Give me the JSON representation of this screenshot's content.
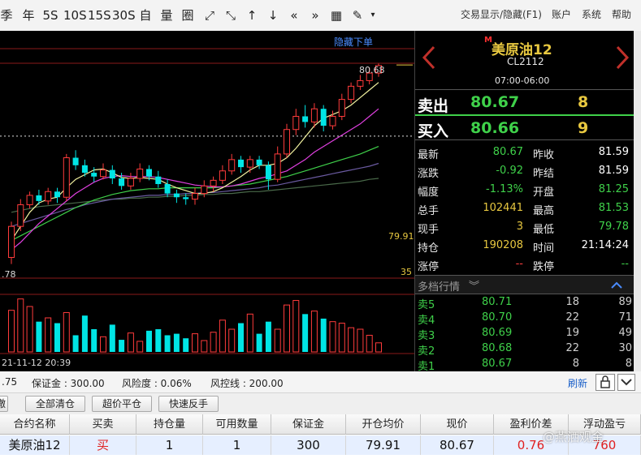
{
  "toolbar": {
    "periods": [
      "季",
      "年",
      "5S",
      "10S",
      "15S",
      "30S",
      "自",
      "量",
      "圈"
    ],
    "tools": [
      "⤢",
      "⤡",
      "↑",
      "↓",
      "«",
      "»",
      "▦",
      "✎",
      "▾"
    ],
    "right": {
      "f1": "交易显示/隐藏(F1)",
      "account": "账户",
      "system": "系统",
      "help": "帮助"
    }
  },
  "chart": {
    "hide_order": "隐藏下单",
    "high_label": "80.68",
    "price_line_label": "79.91",
    "left_low_label": ".78",
    "ma_label": "35",
    "date_label": "21-11-12 20:39"
  },
  "chart_data": {
    "type": "candlestick",
    "candles": [
      {
        "o": 78.62,
        "c": 78.95,
        "h": 79.0,
        "l": 78.55
      },
      {
        "o": 78.95,
        "c": 79.18,
        "h": 79.24,
        "l": 78.9
      },
      {
        "o": 79.18,
        "c": 79.28,
        "h": 79.32,
        "l": 79.14
      },
      {
        "o": 79.28,
        "c": 79.22,
        "h": 79.34,
        "l": 79.18
      },
      {
        "o": 79.22,
        "c": 79.32,
        "h": 79.36,
        "l": 79.18
      },
      {
        "o": 79.32,
        "c": 79.26,
        "h": 79.36,
        "l": 79.2
      },
      {
        "o": 79.26,
        "c": 79.68,
        "h": 79.72,
        "l": 79.22
      },
      {
        "o": 79.68,
        "c": 79.6,
        "h": 79.76,
        "l": 79.55
      },
      {
        "o": 79.6,
        "c": 79.52,
        "h": 79.66,
        "l": 79.48
      },
      {
        "o": 79.52,
        "c": 79.48,
        "h": 79.58,
        "l": 79.42
      },
      {
        "o": 79.48,
        "c": 79.55,
        "h": 79.62,
        "l": 79.45
      },
      {
        "o": 79.55,
        "c": 79.46,
        "h": 79.6,
        "l": 79.4
      },
      {
        "o": 79.46,
        "c": 79.38,
        "h": 79.52,
        "l": 79.34
      },
      {
        "o": 79.38,
        "c": 79.46,
        "h": 79.52,
        "l": 79.34
      },
      {
        "o": 79.46,
        "c": 79.56,
        "h": 79.62,
        "l": 79.42
      },
      {
        "o": 79.56,
        "c": 79.48,
        "h": 79.6,
        "l": 79.44
      },
      {
        "o": 79.48,
        "c": 79.4,
        "h": 79.54,
        "l": 79.36
      },
      {
        "o": 79.4,
        "c": 79.3,
        "h": 79.45,
        "l": 79.26
      },
      {
        "o": 79.3,
        "c": 79.26,
        "h": 79.34,
        "l": 79.2
      },
      {
        "o": 79.26,
        "c": 79.24,
        "h": 79.3,
        "l": 79.18
      },
      {
        "o": 79.24,
        "c": 79.3,
        "h": 79.36,
        "l": 79.18
      },
      {
        "o": 79.3,
        "c": 79.38,
        "h": 79.44,
        "l": 79.26
      },
      {
        "o": 79.38,
        "c": 79.44,
        "h": 79.48,
        "l": 79.32
      },
      {
        "o": 79.44,
        "c": 79.54,
        "h": 79.6,
        "l": 79.4
      },
      {
        "o": 79.54,
        "c": 79.66,
        "h": 79.72,
        "l": 79.5
      },
      {
        "o": 79.66,
        "c": 79.58,
        "h": 79.7,
        "l": 79.52
      },
      {
        "o": 79.58,
        "c": 79.66,
        "h": 79.7,
        "l": 79.52
      },
      {
        "o": 79.66,
        "c": 79.6,
        "h": 79.7,
        "l": 79.56
      },
      {
        "o": 79.6,
        "c": 79.45,
        "h": 79.64,
        "l": 79.34
      },
      {
        "o": 79.45,
        "c": 79.72,
        "h": 79.8,
        "l": 79.42
      },
      {
        "o": 79.72,
        "c": 79.98,
        "h": 80.04,
        "l": 79.68
      },
      {
        "o": 79.98,
        "c": 80.12,
        "h": 80.2,
        "l": 79.92
      },
      {
        "o": 80.12,
        "c": 80.06,
        "h": 80.24,
        "l": 80.0
      },
      {
        "o": 80.06,
        "c": 80.2,
        "h": 80.26,
        "l": 80.0
      },
      {
        "o": 80.2,
        "c": 80.02,
        "h": 80.24,
        "l": 79.96
      },
      {
        "o": 80.02,
        "c": 80.12,
        "h": 80.18,
        "l": 79.98
      },
      {
        "o": 80.12,
        "c": 80.3,
        "h": 80.36,
        "l": 80.08
      },
      {
        "o": 80.3,
        "c": 80.44,
        "h": 80.48,
        "l": 80.26
      },
      {
        "o": 80.44,
        "c": 80.5,
        "h": 80.56,
        "l": 80.4
      },
      {
        "o": 80.5,
        "c": 80.58,
        "h": 80.64,
        "l": 80.46
      },
      {
        "o": 80.58,
        "c": 80.66,
        "h": 80.68,
        "l": 80.54
      }
    ],
    "volumes": [
      55,
      70,
      60,
      40,
      45,
      38,
      52,
      22,
      48,
      30,
      20,
      36,
      16,
      25,
      14,
      28,
      30,
      22,
      24,
      18,
      24,
      15,
      26,
      42,
      30,
      38,
      50,
      24,
      40,
      30,
      62,
      68,
      50,
      54,
      44,
      40,
      38,
      32,
      30,
      22,
      12
    ],
    "ma5": [
      78.8,
      78.95,
      79.1,
      79.2,
      79.24,
      79.26,
      79.36,
      79.45,
      79.5,
      79.55,
      79.56,
      79.52,
      79.47,
      79.46,
      79.47,
      79.46,
      79.45,
      79.4,
      79.36,
      79.33,
      79.3,
      79.3,
      79.32,
      79.36,
      79.42,
      79.48,
      79.55,
      79.6,
      79.6,
      79.62,
      79.68,
      79.78,
      79.9,
      80.02,
      80.1,
      80.14,
      80.18,
      80.24,
      80.32,
      80.4,
      80.48
    ],
    "ma10": [
      78.7,
      78.78,
      78.88,
      78.98,
      79.06,
      79.14,
      79.22,
      79.3,
      79.36,
      79.42,
      79.46,
      79.48,
      79.49,
      79.48,
      79.48,
      79.48,
      79.47,
      79.45,
      79.43,
      79.41,
      79.39,
      79.38,
      79.37,
      79.37,
      79.38,
      79.4,
      79.43,
      79.46,
      79.48,
      79.51,
      79.54,
      79.6,
      79.66,
      79.74,
      79.8,
      79.86,
      79.92,
      79.98,
      80.04,
      80.12,
      80.2
    ],
    "ma20": [
      78.8,
      78.85,
      78.9,
      78.95,
      79.0,
      79.05,
      79.1,
      79.15,
      79.19,
      79.23,
      79.26,
      79.29,
      79.31,
      79.33,
      79.34,
      79.35,
      79.35,
      79.36,
      79.36,
      79.36,
      79.36,
      79.36,
      79.36,
      79.37,
      79.38,
      79.39,
      79.4,
      79.42,
      79.44,
      79.46,
      79.48,
      79.51,
      79.54,
      79.57,
      79.6,
      79.63,
      79.66,
      79.69,
      79.72,
      79.76,
      79.8
    ],
    "ma30": [
      78.95,
      78.98,
      79.01,
      79.04,
      79.07,
      79.1,
      79.13,
      79.15,
      79.18,
      79.2,
      79.22,
      79.24,
      79.25,
      79.26,
      79.27,
      79.28,
      79.28,
      79.29,
      79.29,
      79.3,
      79.3,
      79.31,
      79.31,
      79.32,
      79.33,
      79.34,
      79.35,
      79.36,
      79.38,
      79.39,
      79.41,
      79.43,
      79.45,
      79.47,
      79.49,
      79.51,
      79.53,
      79.55,
      79.57,
      79.59,
      79.62
    ],
    "ma60": [
      79.1,
      79.12,
      79.14,
      79.16,
      79.17,
      79.18,
      79.19,
      79.2,
      79.21,
      79.22,
      79.23,
      79.24,
      79.24,
      79.25,
      79.25,
      79.26,
      79.26,
      79.27,
      79.27,
      79.28,
      79.28,
      79.29,
      79.29,
      79.3,
      79.3,
      79.31,
      79.32,
      79.32,
      79.33,
      79.34,
      79.35,
      79.36,
      79.37,
      79.38,
      79.39,
      79.4,
      79.41,
      79.42,
      79.43,
      79.45,
      79.46
    ]
  },
  "quote": {
    "mark": "M",
    "name": "美原油12",
    "code": "CL2112",
    "session": "07:00-06:00",
    "sell_label": "卖出",
    "sell_price": "80.67",
    "sell_qty": "8",
    "buy_label": "买入",
    "buy_price": "80.66",
    "buy_qty": "9",
    "fields": [
      {
        "l1": "最新",
        "v1": "80.67",
        "c1": "#3fd14a",
        "l2": "昨收",
        "v2": "81.59",
        "c2": "#ffffff"
      },
      {
        "l1": "涨跌",
        "v1": "-0.92",
        "c1": "#3fd14a",
        "l2": "昨结",
        "v2": "81.59",
        "c2": "#ffffff"
      },
      {
        "l1": "幅度",
        "v1": "-1.13%",
        "c1": "#3fd14a",
        "l2": "开盘",
        "v2": "81.25",
        "c2": "#3fd14a"
      },
      {
        "l1": "总手",
        "v1": "102441",
        "c1": "#e8c840",
        "l2": "最高",
        "v2": "81.53",
        "c2": "#3fd14a"
      },
      {
        "l1": "现手",
        "v1": "3",
        "c1": "#e8c840",
        "l2": "最低",
        "v2": "79.78",
        "c2": "#3fd14a"
      },
      {
        "l1": "持仓",
        "v1": "190208",
        "c1": "#e8c840",
        "l2": "时间",
        "v2": "21:14:24",
        "c2": "#ffffff"
      },
      {
        "l1": "涨停",
        "v1": "--",
        "c1": "#ff4040",
        "l2": "跌停",
        "v2": "--",
        "c2": "#3fd14a"
      }
    ],
    "depth_title": "多档行情",
    "depth": [
      {
        "label": "卖5",
        "price": "80.71",
        "qty": "18",
        "total": "89"
      },
      {
        "label": "卖4",
        "price": "80.70",
        "qty": "22",
        "total": "71"
      },
      {
        "label": "卖3",
        "price": "80.69",
        "qty": "19",
        "total": "49"
      },
      {
        "label": "卖2",
        "price": "80.68",
        "qty": "22",
        "total": "30"
      },
      {
        "label": "卖1",
        "price": "80.67",
        "qty": "8",
        "total": "8"
      }
    ]
  },
  "account": {
    "equity": ".75",
    "margin": "保证金 : 300.00",
    "risk": "风险度 : 0.06%",
    "riskline": "风控线 : 200.00",
    "refresh": "刷新"
  },
  "buttons": {
    "b0": "撤",
    "clear": "全部清仓",
    "close": "超价平仓",
    "reverse": "快速反手"
  },
  "table": {
    "headers": [
      "合约名称",
      "买卖",
      "持仓量",
      "可用数量",
      "保证金",
      "开仓均价",
      "现价",
      "盈利价差",
      "浮动盈亏"
    ],
    "row": {
      "name": "美原油12",
      "side": "买",
      "pos": "1",
      "avail": "1",
      "margin": "300",
      "open": "79.91",
      "price": "80.67",
      "diff": "0.76",
      "pnl": "760"
    },
    "watermark": "@燕洒观金"
  }
}
